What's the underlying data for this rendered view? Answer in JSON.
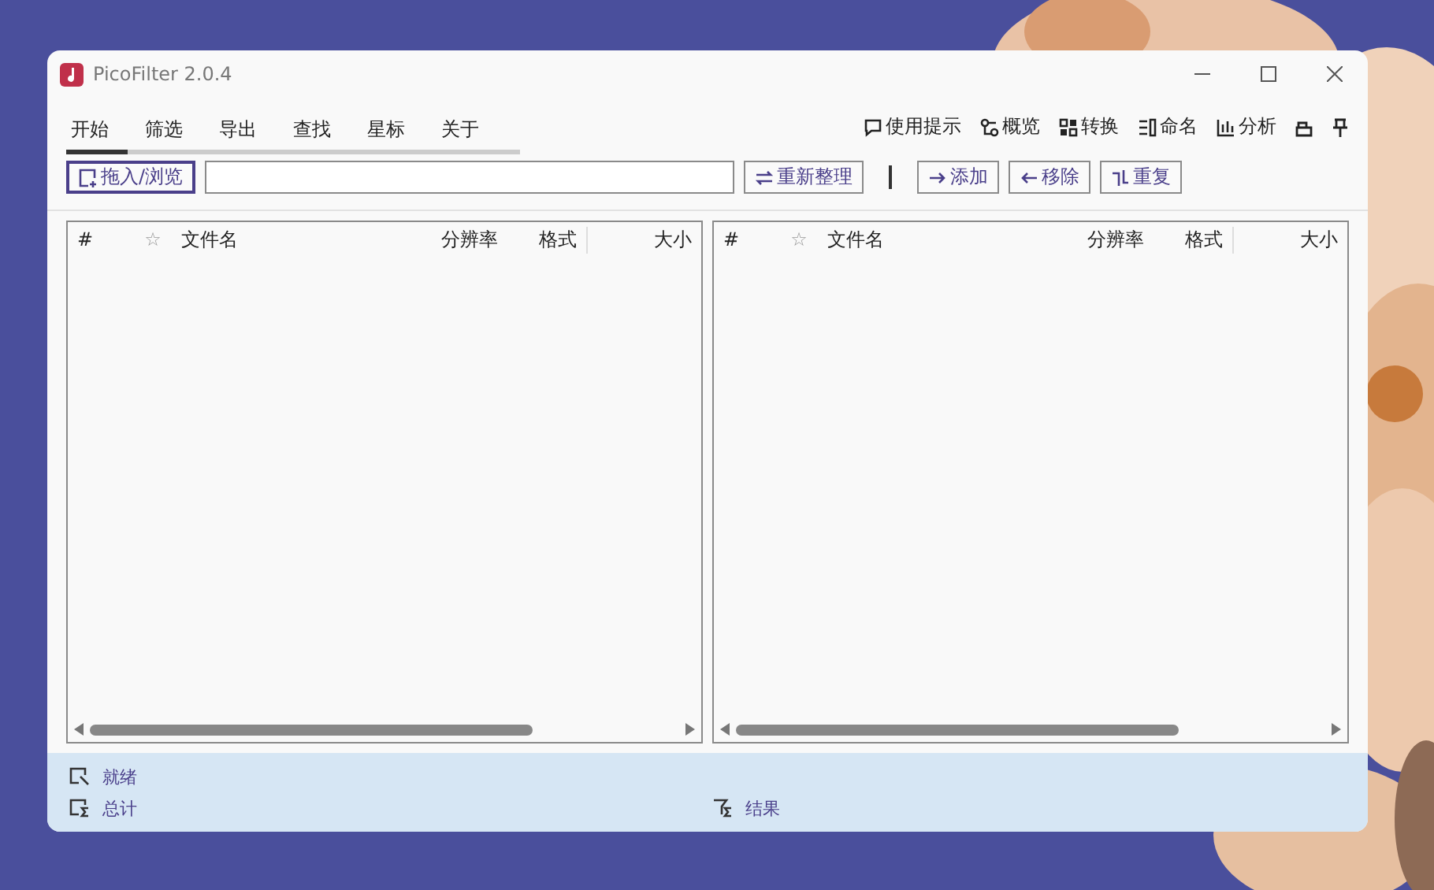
{
  "window": {
    "title": "PicoFilter 2.0.4"
  },
  "tabs": [
    {
      "label": "开始",
      "selected": true
    },
    {
      "label": "筛选",
      "selected": false
    },
    {
      "label": "导出",
      "selected": false
    },
    {
      "label": "查找",
      "selected": false
    },
    {
      "label": "星标",
      "selected": false
    },
    {
      "label": "关于",
      "selected": false
    }
  ],
  "tools": [
    {
      "label": "使用提示",
      "kind": "tips"
    },
    {
      "label": "概览",
      "kind": "overview"
    },
    {
      "label": "转换",
      "kind": "convert"
    },
    {
      "label": "命名",
      "kind": "rename"
    },
    {
      "label": "分析",
      "kind": "analyze"
    }
  ],
  "toolbar": {
    "browse_button": "拖入/浏览",
    "buttons": [
      {
        "label": "重新整理",
        "kind": "refresh"
      },
      {
        "label": "添加",
        "kind": "add"
      },
      {
        "label": "移除",
        "kind": "remove"
      },
      {
        "label": "重复",
        "kind": "duplicate"
      }
    ]
  },
  "panels": [
    {
      "columns": [
        "#",
        "☆",
        "文件名",
        "分辨率",
        "格式",
        "大小"
      ]
    },
    {
      "columns": [
        "#",
        "☆",
        "文件名",
        "分辨率",
        "格式",
        "大小"
      ]
    }
  ],
  "status_bar": {
    "ready": "就绪",
    "total": "总计",
    "result": "结果"
  }
}
